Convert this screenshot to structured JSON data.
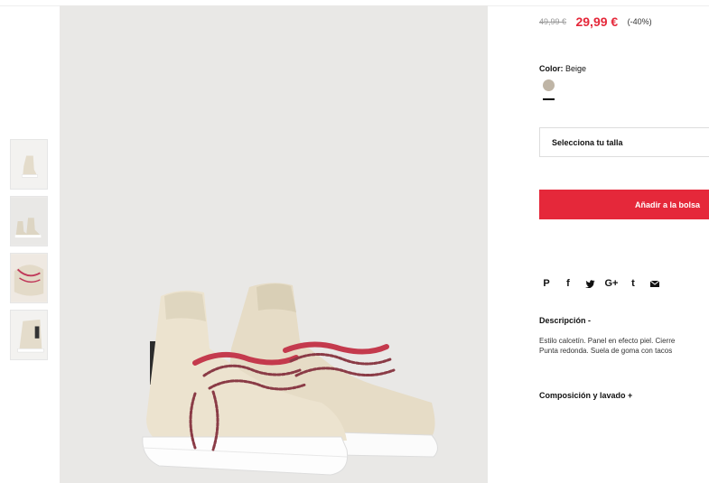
{
  "product": {
    "old_price": "49,99 €",
    "new_price": "29,99 €",
    "discount": "(-40%)",
    "color_label": "Color:",
    "color_value": "Beige",
    "color_swatch": "#bfb5a6",
    "size_placeholder": "Selecciona tu talla",
    "add_to_bag": "Añadir a la bolsa"
  },
  "share": {
    "icons": [
      "pinterest-icon",
      "facebook-icon",
      "twitter-icon",
      "google-plus-icon",
      "tumblr-icon",
      "email-icon"
    ],
    "pinterest": "P",
    "facebook": "f",
    "googleplus": "G+",
    "tumblr": "t"
  },
  "description": {
    "title": "Descripción -",
    "line1": "Estilo calcetín. Panel en efecto piel. Cierre",
    "line2": "Punta redonda. Suela de goma con tacos"
  },
  "composition": {
    "title": "Composición y lavado +"
  },
  "colors": {
    "accent": "#e5283a",
    "image_bg": "#e9e8e6"
  }
}
